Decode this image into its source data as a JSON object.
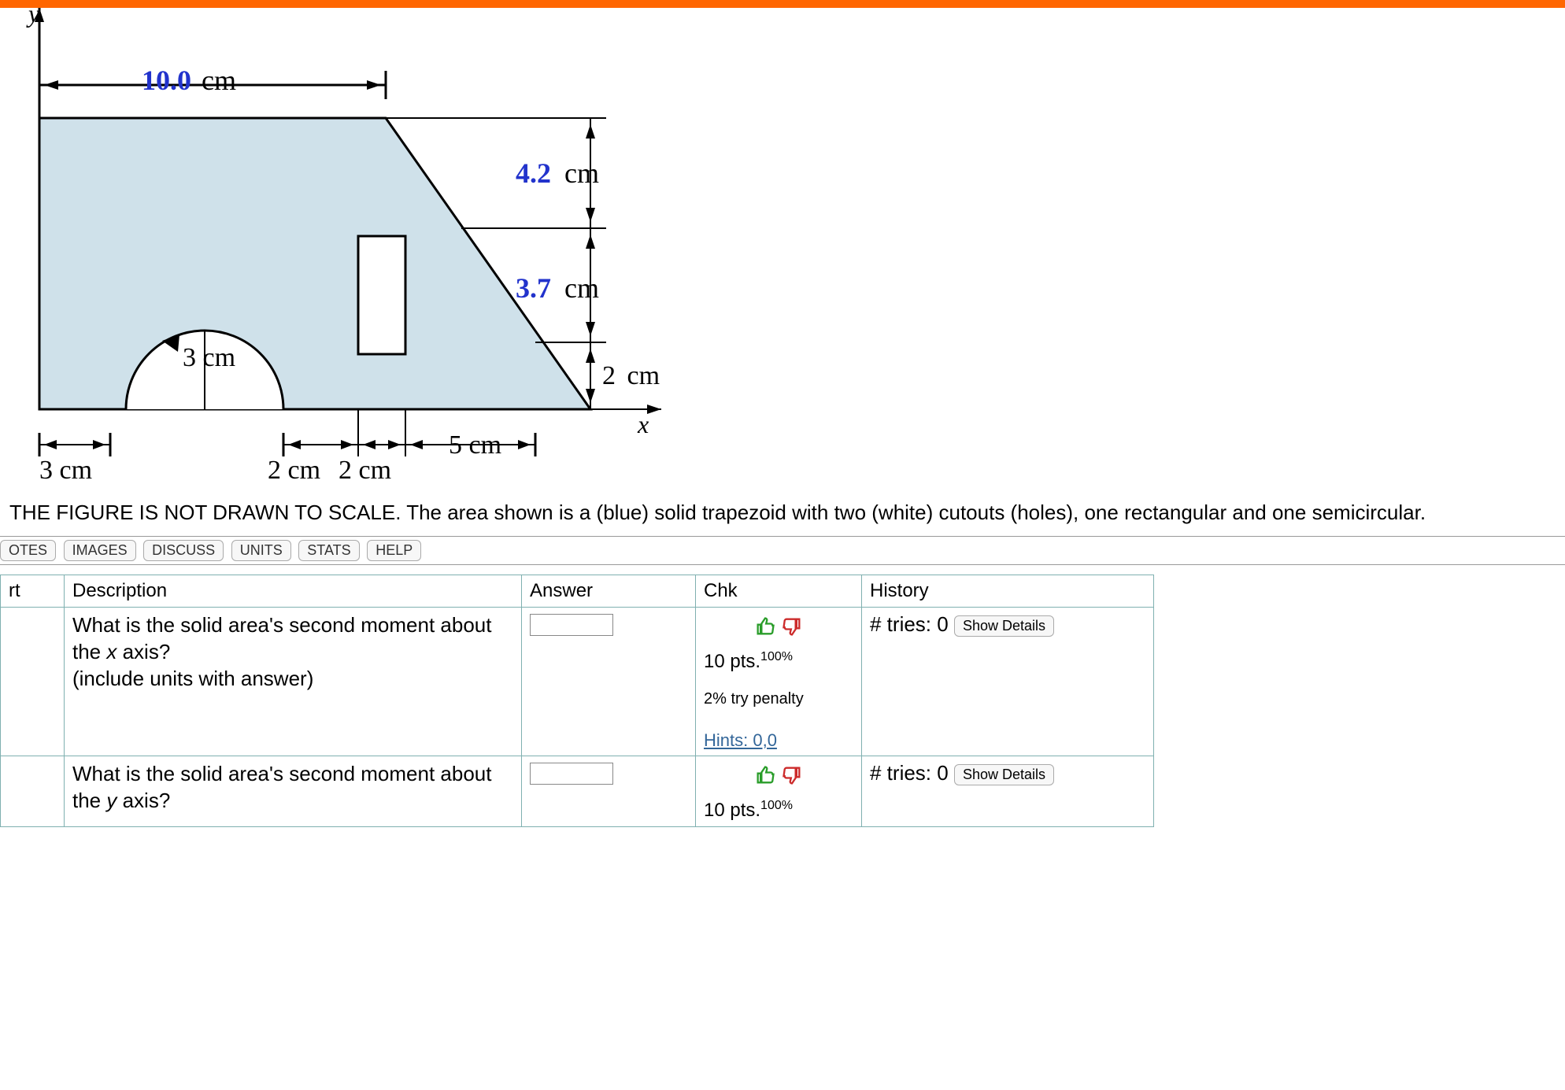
{
  "figure": {
    "y_axis": "y",
    "x_axis": "x",
    "top_width": "10.0",
    "top_unit": "cm",
    "right_upper": "4.2",
    "right_upper_unit": "cm",
    "right_mid": "3.7",
    "right_mid_unit": "cm",
    "right_lower": "2",
    "right_lower_unit": "cm",
    "semicircle_r": "3 cm",
    "bottom_left": "3 cm",
    "rect_left": "2 cm",
    "rect_right": "2 cm",
    "slant_span": "5 cm"
  },
  "caption": "THE FIGURE IS NOT DRAWN TO SCALE. The area shown is a (blue) solid trapezoid with two (white) cutouts (holes), one rectangular and one semicircular.",
  "tabs": [
    "OTES",
    "IMAGES",
    "DISCUSS",
    "UNITS",
    "STATS",
    "HELP"
  ],
  "table": {
    "headers": {
      "rt": "rt",
      "desc": "Description",
      "ans": "Answer",
      "chk": "Chk",
      "hist": "History"
    },
    "rows": [
      {
        "desc_pre": "What is the solid area's second moment about the ",
        "axis": "x",
        "desc_post": " axis?",
        "sub": "(include units with answer)",
        "pts": "10 pts.",
        "pct": "100%",
        "penalty": "2% try penalty",
        "hints": "Hints: 0,0",
        "tries": "# tries: 0",
        "details": "Show Details"
      },
      {
        "desc_pre": "What is the solid area's second moment about the ",
        "axis": "y",
        "desc_post": " axis?",
        "sub": "",
        "pts": "10 pts.",
        "pct": "100%",
        "penalty": "",
        "hints": "",
        "tries": "# tries: 0",
        "details": "Show Details"
      }
    ]
  }
}
